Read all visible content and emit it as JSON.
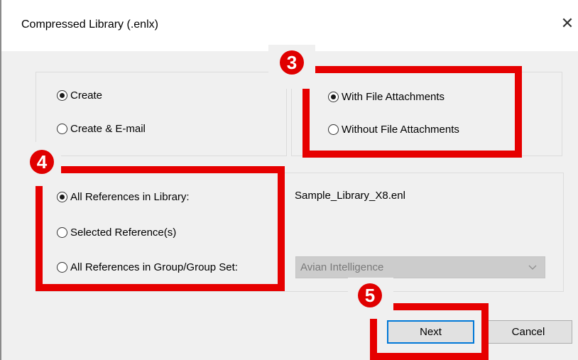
{
  "dialog": {
    "title": "Compressed Library (.enlx)",
    "close_glyph": "✕"
  },
  "action_group": {
    "options": [
      {
        "label": "Create",
        "selected": true
      },
      {
        "label": "Create & E-mail",
        "selected": false
      }
    ]
  },
  "attachments_group": {
    "options": [
      {
        "label": "With File Attachments",
        "selected": true
      },
      {
        "label": "Without File Attachments",
        "selected": false
      }
    ]
  },
  "references_group": {
    "options": [
      {
        "label": "All References in Library:",
        "selected": true
      },
      {
        "label": "Selected Reference(s)",
        "selected": false
      },
      {
        "label": "All References in Group/Group Set:",
        "selected": false
      }
    ],
    "library_name": "Sample_Library_X8.enl",
    "group_dropdown": {
      "value": "Avian Intelligence",
      "enabled": false
    }
  },
  "buttons": {
    "next": "Next",
    "cancel": "Cancel"
  },
  "annotations": {
    "step3": "3",
    "step4": "4",
    "step5": "5",
    "highlight_color": "#e60000"
  }
}
